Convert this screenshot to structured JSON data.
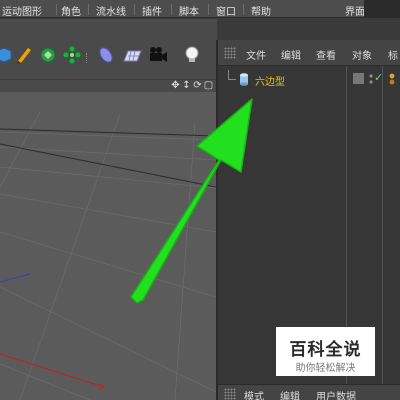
{
  "menubar": {
    "items": [
      "运动图形",
      "角色",
      "流水线",
      "插件",
      "脚本",
      "窗口",
      "帮助"
    ],
    "layout_label": "界面"
  },
  "viewport": {
    "nav_icons": [
      "move-icon",
      "zoom-icon",
      "rotate-icon",
      "maximize-icon"
    ]
  },
  "object_manager": {
    "menu": [
      "文件",
      "编辑",
      "查看",
      "对象",
      "标"
    ],
    "objects": [
      {
        "name": "六边型",
        "icon": "cylinder-icon",
        "visible": true
      }
    ]
  },
  "attributes": {
    "menu": [
      "模式",
      "编辑",
      "用户数据"
    ]
  },
  "watermark": {
    "title": "百科全说",
    "subtitle": "助你轻松解决"
  },
  "colors": {
    "object_name": "#f2c200",
    "arrow": "#22e01e",
    "viewport_bg": "#5b5b5b",
    "panel_bg": "#363636"
  }
}
